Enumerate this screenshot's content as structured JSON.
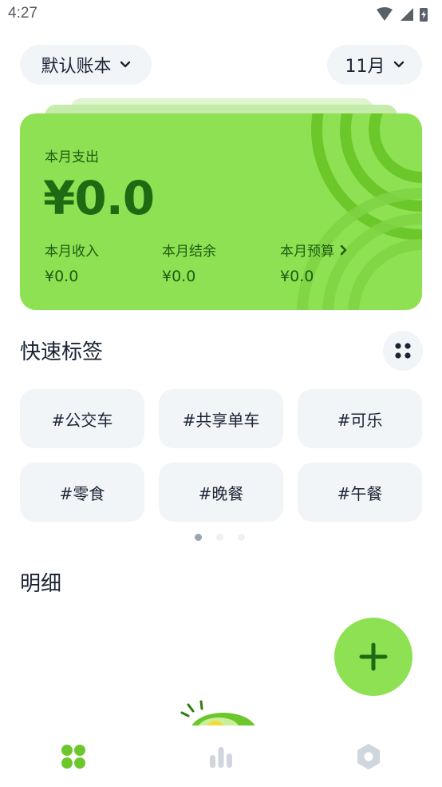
{
  "status_bar": {
    "time": "4:27",
    "icons": [
      "wifi-icon",
      "signal-icon",
      "battery-charging-icon"
    ]
  },
  "header": {
    "account_label": "默认账本",
    "month_label": "11月"
  },
  "summary": {
    "spend_label": "本月支出",
    "spend_value": "¥0.0",
    "income_label": "本月收入",
    "income_value": "¥0.0",
    "balance_label": "本月结余",
    "balance_value": "¥0.0",
    "budget_label": "本月预算",
    "budget_value": "¥0.0"
  },
  "quick_tags": {
    "title": "快速标签",
    "tags": [
      "#公交车",
      "#共享单车",
      "#可乐",
      "#零食",
      "#晚餐",
      "#午餐"
    ],
    "pages": 3,
    "active_page": 1
  },
  "detail": {
    "title": "明细"
  },
  "bottom_nav": {
    "items": [
      "home-grid-icon",
      "stats-icon",
      "settings-icon"
    ],
    "active": "home-grid-icon"
  },
  "colors": {
    "accent": "#8ee152",
    "accent_dark": "#1e6a12",
    "pill_bg": "#f2f5f8",
    "nav_active": "#6cc82a",
    "nav_inactive": "#cfd6de"
  }
}
